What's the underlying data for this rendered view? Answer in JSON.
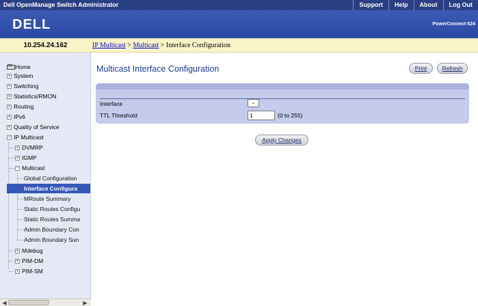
{
  "app": {
    "title": "Dell OpenManage Switch Administrator",
    "top_links": [
      "Support",
      "Help",
      "About",
      "Log Out"
    ],
    "logo_text": "DELL",
    "product": "PowerConnect 624"
  },
  "ip_address": "10.254.24.162",
  "breadcrumb": {
    "items": [
      "IP Multicast",
      "Multicast"
    ],
    "separator": " > ",
    "current": "Interface Configuration"
  },
  "nav": {
    "items": [
      {
        "label": "Home",
        "icon": "home-icon"
      },
      {
        "label": "System",
        "icon": "expand-icon"
      },
      {
        "label": "Switching",
        "icon": "expand-icon"
      },
      {
        "label": "Statistics/RMON",
        "icon": "expand-icon"
      },
      {
        "label": "Routing",
        "icon": "expand-icon"
      },
      {
        "label": "IPv6",
        "icon": "expand-icon"
      },
      {
        "label": "Quality of Service",
        "icon": "expand-icon"
      },
      {
        "label": "IP Multicast",
        "icon": "collapse-icon"
      },
      {
        "label": "DVMRP",
        "icon": "expand-icon"
      },
      {
        "label": "IGMP",
        "icon": "expand-icon"
      },
      {
        "label": "Multicast",
        "icon": "collapse-icon"
      },
      {
        "label": "Global Configuration",
        "icon": ""
      },
      {
        "label": "Interface Configura",
        "icon": "",
        "selected": true
      },
      {
        "label": "MRoute Summary",
        "icon": ""
      },
      {
        "label": "Static Routes Configu",
        "icon": ""
      },
      {
        "label": "Static Routes Summa",
        "icon": ""
      },
      {
        "label": "Admin Boundary Con",
        "icon": ""
      },
      {
        "label": "Admin Boundary Sun",
        "icon": ""
      },
      {
        "label": "Mdebug",
        "icon": "expand-icon"
      },
      {
        "label": "PIM-DM",
        "icon": "expand-icon"
      },
      {
        "label": "PIM-SM",
        "icon": "expand-icon"
      }
    ]
  },
  "page": {
    "title": "Multicast Interface Configuration",
    "print_label": "Print",
    "refresh_label": "Refresh",
    "apply_label": "Apply Changes"
  },
  "form": {
    "interface_label": "Interface",
    "interface_value": "",
    "ttl_label": "TTL Threshold",
    "ttl_value": "1",
    "ttl_hint": "(0 to 255)"
  },
  "colors": {
    "topbar": "#2b3f84",
    "header": "#3a5ab4",
    "nav_bg": "#e4e9f5",
    "selected": "#3557b7",
    "panel": "#c4cbeb",
    "title": "#1a3d91",
    "link": "#0000cc"
  }
}
